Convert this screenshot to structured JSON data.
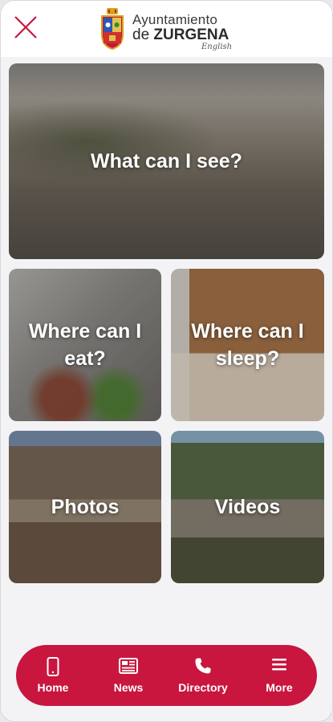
{
  "header": {
    "logo_line1": "Ayuntamiento",
    "logo_line2_prefix": "de ",
    "logo_line2_bold": "ZURGENA",
    "logo_line3": "English",
    "close_icon": "close-icon",
    "crest_icon": "coat-of-arms-icon"
  },
  "tiles": [
    {
      "label": "What can I see?"
    },
    {
      "label": "Where can I eat?"
    },
    {
      "label": "Where can I sleep?"
    },
    {
      "label": "Photos"
    },
    {
      "label": "Videos"
    }
  ],
  "nav": {
    "items": [
      {
        "label": "Home",
        "icon": "phone-icon"
      },
      {
        "label": "News",
        "icon": "newspaper-icon"
      },
      {
        "label": "Directory",
        "icon": "phone-handset-icon"
      },
      {
        "label": "More",
        "icon": "hamburger-menu-icon"
      }
    ]
  },
  "colors": {
    "accent": "#c8163f",
    "close": "#c8163f",
    "background": "#f3f3f5"
  }
}
